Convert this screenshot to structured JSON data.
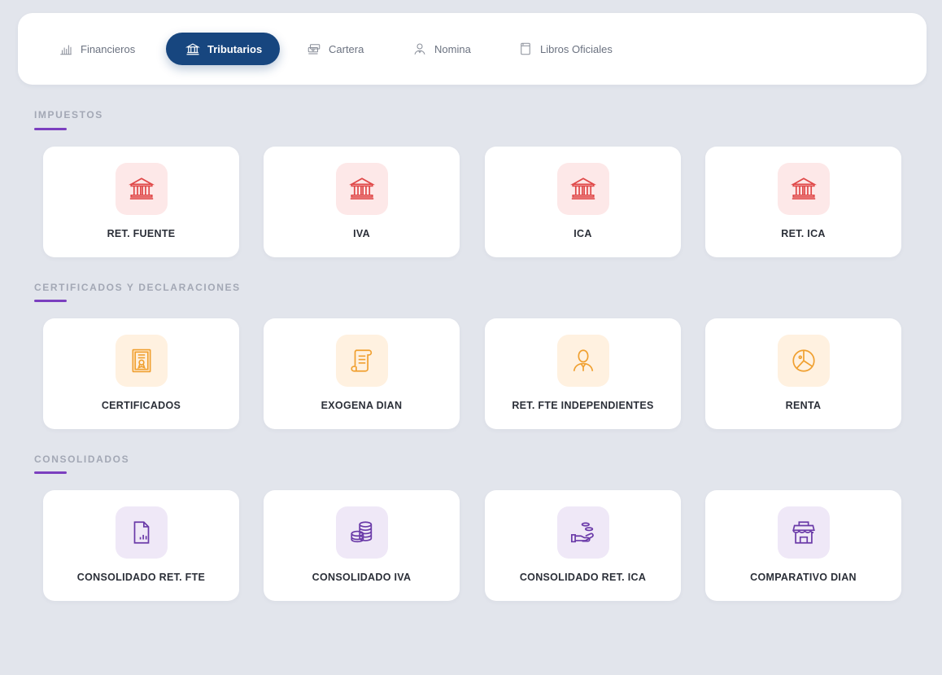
{
  "tabs": [
    {
      "label": "Financieros",
      "icon": "bar-chart-icon",
      "active": false
    },
    {
      "label": "Tributarios",
      "icon": "bank-icon",
      "active": true
    },
    {
      "label": "Cartera",
      "icon": "money-stack-icon",
      "active": false
    },
    {
      "label": "Nomina",
      "icon": "person-icon",
      "active": false
    },
    {
      "label": "Libros Oficiales",
      "icon": "book-icon",
      "active": false
    }
  ],
  "sections": [
    {
      "title": "IMPUESTOS",
      "accent": "#7b3fbf",
      "cards": [
        {
          "label": "RET. FUENTE",
          "icon": "bank-icon",
          "color": "#e04848"
        },
        {
          "label": "IVA",
          "icon": "bank-icon",
          "color": "#e04848"
        },
        {
          "label": "ICA",
          "icon": "bank-icon",
          "color": "#e04848"
        },
        {
          "label": "RET. ICA",
          "icon": "bank-icon",
          "color": "#e04848"
        }
      ]
    },
    {
      "title": "CERTIFICADOS Y DECLARACIONES",
      "accent": "#7b3fbf",
      "cards": [
        {
          "label": "CERTIFICADOS",
          "icon": "certificate-icon",
          "color": "#f0a030"
        },
        {
          "label": "EXOGENA DIAN",
          "icon": "scroll-icon",
          "color": "#f0a030"
        },
        {
          "label": "RET. FTE INDEPENDIENTES",
          "icon": "person-icon",
          "color": "#f0a030"
        },
        {
          "label": "RENTA",
          "icon": "pie-chart-icon",
          "color": "#f0a030"
        }
      ]
    },
    {
      "title": "CONSOLIDADOS",
      "accent": "#7b3fbf",
      "cards": [
        {
          "label": "CONSOLIDADO RET. FTE",
          "icon": "document-chart-icon",
          "color": "#6a3aa8"
        },
        {
          "label": "CONSOLIDADO IVA",
          "icon": "coins-icon",
          "color": "#6a3aa8"
        },
        {
          "label": "CONSOLIDADO RET. ICA",
          "icon": "hand-coins-icon",
          "color": "#6a3aa8"
        },
        {
          "label": "COMPARATIVO DIAN",
          "icon": "store-icon",
          "color": "#6a3aa8"
        }
      ]
    }
  ]
}
